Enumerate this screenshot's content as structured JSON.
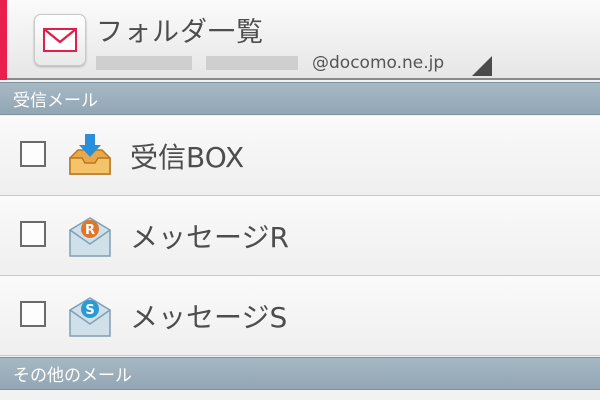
{
  "header": {
    "title": "フォルダ一覧",
    "account_domain": "@docomo.ne.jp",
    "app_icon": "mail-envelope-icon",
    "dropdown_icon": "corner-dropdown-icon",
    "accent_color": "#e8204e"
  },
  "sections": [
    {
      "label": "受信メール"
    },
    {
      "label": "その他のメール"
    }
  ],
  "folders": [
    {
      "label": "受信BOX",
      "icon": "inbox-tray-icon",
      "checked": false
    },
    {
      "label": "メッセージR",
      "icon": "message-r-icon",
      "badge": "R",
      "badge_color": "#e0762a",
      "checked": false
    },
    {
      "label": "メッセージS",
      "icon": "message-s-icon",
      "badge": "S",
      "badge_color": "#2a9ad6",
      "checked": false
    }
  ]
}
